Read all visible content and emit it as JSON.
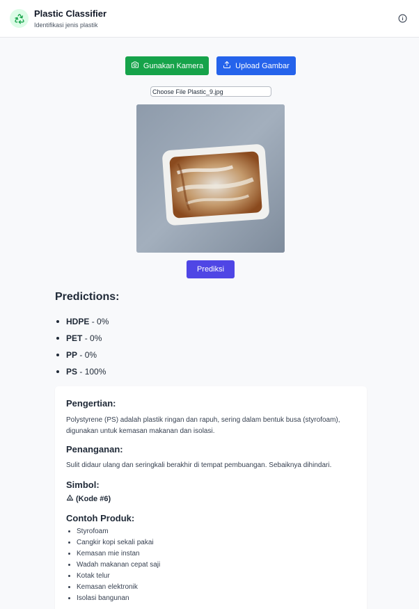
{
  "header": {
    "title": "Plastic Classifier",
    "subtitle": "Identifikasi jenis plastik",
    "logo_icon": "recycle-icon",
    "info_icon": "info-icon"
  },
  "actions": {
    "camera_label": "Gunakan Kamera",
    "camera_icon": "camera-icon",
    "upload_label": "Upload Gambar",
    "upload_icon": "upload-icon"
  },
  "file_input": {
    "button_label": "Choose File",
    "file_name": "Plastic_9.jpg"
  },
  "predict_label": "Prediksi",
  "predictions": {
    "title": "Predictions:",
    "items": [
      {
        "name": "HDPE",
        "value": "- 0%"
      },
      {
        "name": "PET",
        "value": "- 0%"
      },
      {
        "name": "PP",
        "value": "- 0%"
      },
      {
        "name": "PS",
        "value": "- 100%"
      }
    ]
  },
  "info": {
    "pengertian_title": "Pengertian:",
    "pengertian_text": "Polystyrene (PS) adalah plastik ringan dan rapuh, sering dalam bentuk busa (styrofoam), digunakan untuk kemasan makanan dan isolasi.",
    "penanganan_title": "Penanganan:",
    "penanganan_text": "Sulit didaur ulang dan seringkali berakhir di tempat pembuangan. Sebaiknya dihindari.",
    "simbol_title": "Simbol:",
    "simbol_value": "(Kode #6)",
    "simbol_icon": "recycle-symbol-icon",
    "contoh_title": "Contoh Produk:",
    "contoh_items": [
      "Styrofoam",
      "Cangkir kopi sekali pakai",
      "Kemasan mie instan",
      "Wadah makanan cepat saji",
      "Kotak telur",
      "Kemasan elektronik",
      "Isolasi bangunan"
    ]
  },
  "colors": {
    "camera_button": "#16a34a",
    "upload_button": "#2563eb",
    "predict_button": "#4f46e5",
    "logo_bg": "#dcfce7"
  }
}
